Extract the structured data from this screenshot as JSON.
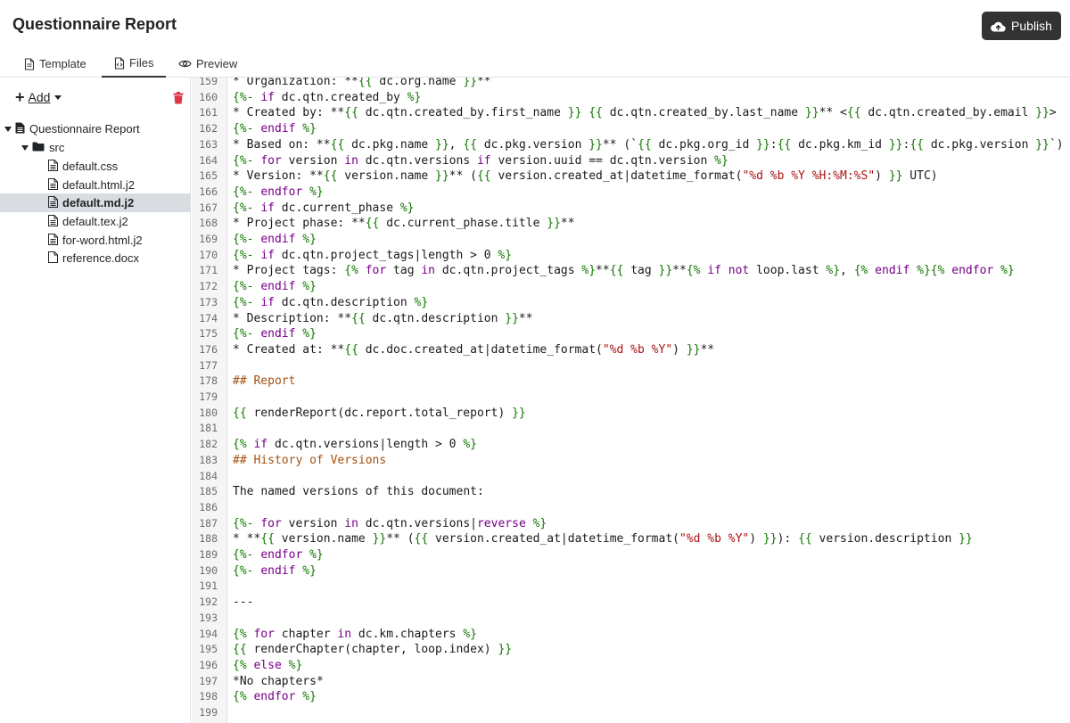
{
  "app": {
    "title": "Questionnaire Report",
    "publish_label": "Publish"
  },
  "tabs": [
    {
      "label": "Template",
      "icon": "file-icon"
    },
    {
      "label": "Files",
      "icon": "file-code-icon",
      "active": true
    },
    {
      "label": "Preview",
      "icon": "eye-icon"
    }
  ],
  "sidebar": {
    "add_label": "Add",
    "tree": [
      {
        "label": "Questionnaire Report",
        "type": "root",
        "level": 0
      },
      {
        "label": "src",
        "type": "folder",
        "level": 1
      },
      {
        "label": "default.css",
        "type": "file",
        "level": 2
      },
      {
        "label": "default.html.j2",
        "type": "file",
        "level": 2
      },
      {
        "label": "default.md.j2",
        "type": "file",
        "level": 2,
        "selected": true
      },
      {
        "label": "default.tex.j2",
        "type": "file",
        "level": 2
      },
      {
        "label": "for-word.html.j2",
        "type": "file",
        "level": 2
      },
      {
        "label": "reference.docx",
        "type": "file",
        "level": 2
      }
    ]
  },
  "editor": {
    "lines": [
      {
        "n": "159",
        "t": "* Organization: **{{ dc.org.name }}**"
      },
      {
        "n": "160",
        "t": "{%- if dc.qtn.created_by %}"
      },
      {
        "n": "161",
        "t": "* Created by: **{{ dc.qtn.created_by.first_name }} {{ dc.qtn.created_by.last_name }}** <{{ dc.qtn.created_by.email }}>"
      },
      {
        "n": "162",
        "t": "{%- endif %}"
      },
      {
        "n": "163",
        "t": "* Based on: **{{ dc.pkg.name }}, {{ dc.pkg.version }}** (`{{ dc.pkg.org_id }}:{{ dc.pkg.km_id }}:{{ dc.pkg.version }}`)"
      },
      {
        "n": "164",
        "t": "{%- for version in dc.qtn.versions if version.uuid == dc.qtn.version %}"
      },
      {
        "n": "165",
        "t": "* Version: **{{ version.name }}** ({{ version.created_at|datetime_format(\"%d %b %Y %H:%M:%S\") }} UTC)"
      },
      {
        "n": "166",
        "t": "{%- endfor %}"
      },
      {
        "n": "167",
        "t": "{%- if dc.current_phase %}"
      },
      {
        "n": "168",
        "t": "* Project phase: **{{ dc.current_phase.title }}**"
      },
      {
        "n": "169",
        "t": "{%- endif %}"
      },
      {
        "n": "170",
        "t": "{%- if dc.qtn.project_tags|length > 0 %}"
      },
      {
        "n": "171",
        "t": "* Project tags: {% for tag in dc.qtn.project_tags %}**{{ tag }}**{% if not loop.last %}, {% endif %}{% endfor %}"
      },
      {
        "n": "172",
        "t": "{%- endif %}"
      },
      {
        "n": "173",
        "t": "{%- if dc.qtn.description %}"
      },
      {
        "n": "174",
        "t": "* Description: **{{ dc.qtn.description }}**"
      },
      {
        "n": "175",
        "t": "{%- endif %}"
      },
      {
        "n": "176",
        "t": "* Created at: **{{ dc.doc.created_at|datetime_format(\"%d %b %Y\") }}**"
      },
      {
        "n": "177",
        "t": ""
      },
      {
        "n": "178",
        "t": "## Report"
      },
      {
        "n": "179",
        "t": ""
      },
      {
        "n": "180",
        "t": "{{ renderReport(dc.report.total_report) }}"
      },
      {
        "n": "181",
        "t": ""
      },
      {
        "n": "182",
        "t": "{% if dc.qtn.versions|length > 0 %}"
      },
      {
        "n": "183",
        "t": "## History of Versions"
      },
      {
        "n": "184",
        "t": ""
      },
      {
        "n": "185",
        "t": "The named versions of this document:"
      },
      {
        "n": "186",
        "t": ""
      },
      {
        "n": "187",
        "t": "{%- for version in dc.qtn.versions|reverse %}"
      },
      {
        "n": "188",
        "t": "* **{{ version.name }}** ({{ version.created_at|datetime_format(\"%d %b %Y\") }}): {{ version.description }}"
      },
      {
        "n": "189",
        "t": "{%- endfor %}"
      },
      {
        "n": "190",
        "t": "{%- endif %}"
      },
      {
        "n": "191",
        "t": ""
      },
      {
        "n": "192",
        "t": "---"
      },
      {
        "n": "193",
        "t": ""
      },
      {
        "n": "194",
        "t": "{% for chapter in dc.km.chapters %}"
      },
      {
        "n": "195",
        "t": "{{ renderChapter(chapter, loop.index) }}"
      },
      {
        "n": "196",
        "t": "{% else %}"
      },
      {
        "n": "197",
        "t": "*No chapters*"
      },
      {
        "n": "198",
        "t": "{% endfor %}"
      },
      {
        "n": "199",
        "t": ""
      }
    ]
  },
  "colors": {
    "publish_bg": "#333333",
    "delete_icon": "#dc3545",
    "selected_row_bg": "#d9dde1",
    "jinja_delim": "#117700",
    "keyword": "#770088",
    "string": "#aa1111",
    "heading": "#a65010"
  }
}
